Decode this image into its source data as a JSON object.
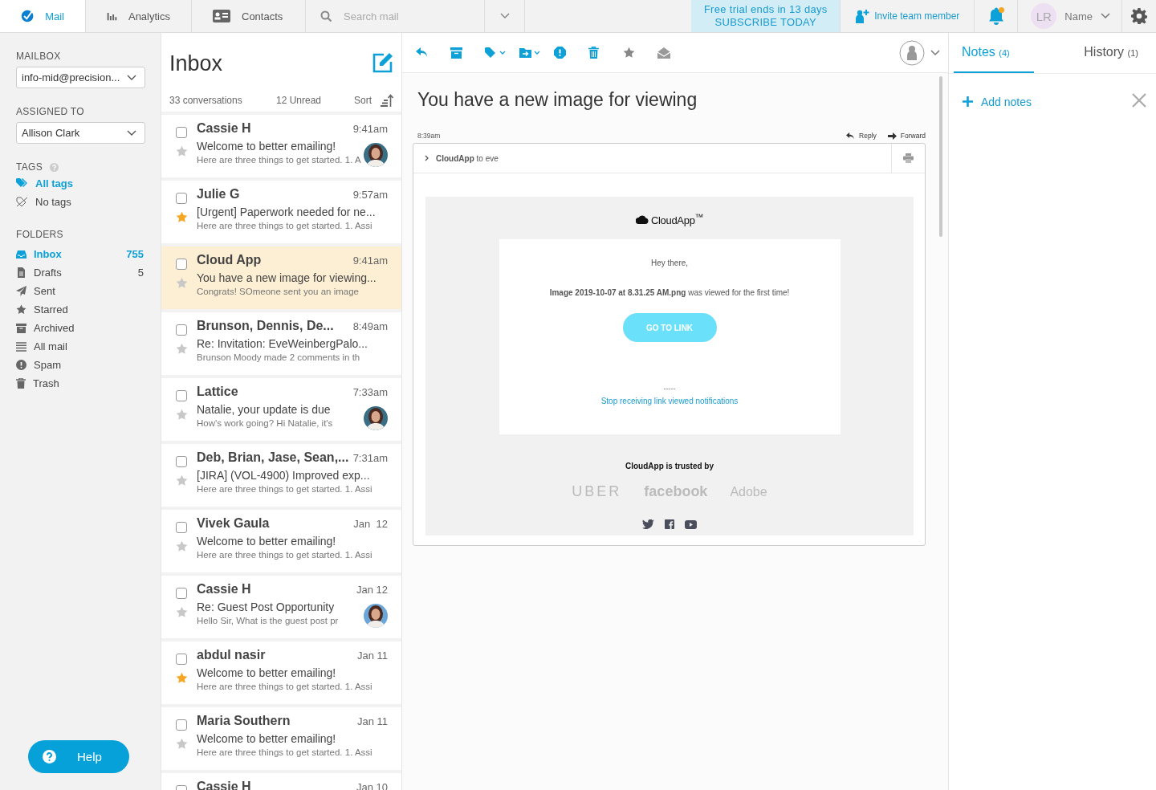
{
  "topbar": {
    "tabs": [
      {
        "label": "Mail",
        "kind": "mail",
        "selected": true
      },
      {
        "label": "Analytics",
        "kind": "analytics",
        "selected": false
      },
      {
        "label": "Contacts",
        "kind": "contacts",
        "selected": false
      }
    ],
    "search": {
      "placeholder": "Search mail"
    },
    "trial": {
      "line1": "Free trial ends in 13 days",
      "line2": "SUBSCRIBE TODAY"
    },
    "invite": "Invite team member",
    "notification_dot": true,
    "user": {
      "initials": "LR",
      "name": "Name"
    }
  },
  "sidebar": {
    "mailbox": {
      "label": "MAILBOX",
      "value": "info-mid@precision..."
    },
    "assigned": {
      "label": "ASSIGNED TO",
      "value": "Allison Clark"
    },
    "tags": {
      "label": "TAGS",
      "items": [
        {
          "label": "All tags",
          "kind": "all",
          "selected": true
        },
        {
          "label": "No tags",
          "kind": "none",
          "selected": false
        }
      ]
    },
    "folders": {
      "label": "FOLDERS",
      "items": [
        {
          "kind": "inbox",
          "label": "Inbox",
          "count": "755",
          "selected": true
        },
        {
          "kind": "drafts",
          "label": "Drafts",
          "count": "5",
          "selected": false
        },
        {
          "kind": "sent",
          "label": "Sent",
          "selected": false
        },
        {
          "kind": "starred",
          "label": "Starred",
          "selected": false
        },
        {
          "kind": "archived",
          "label": "Archived",
          "selected": false
        },
        {
          "kind": "all",
          "label": "All mail",
          "selected": false
        },
        {
          "kind": "spam",
          "label": "Spam",
          "selected": false
        },
        {
          "kind": "trash",
          "label": "Trash",
          "selected": false
        }
      ]
    },
    "help": "Help"
  },
  "list": {
    "title": "Inbox",
    "count": "33 conversations",
    "unread": "12 Unread",
    "sort": "Sort",
    "conversations": [
      {
        "name": "Cassie H",
        "time": "9:41am",
        "subject": "Welcome to better emailing!",
        "preview": "Here are three things to get started. 1. A",
        "starred": false,
        "checked": false,
        "selected": false,
        "avatar": true
      },
      {
        "name": "Julie G",
        "time": "9:57am",
        "subject": "[Urgent] Paperwork needed for ne...",
        "preview": "Here are three things to get started. 1. Assi",
        "starred": true,
        "checked": false,
        "selected": false,
        "avatar": false
      },
      {
        "name": "Cloud App",
        "time": "9:41am",
        "subject": "You have a new image for viewing...",
        "preview": "Congrats! SOmeone sent you an image",
        "starred": false,
        "checked": false,
        "selected": true,
        "avatar": false
      },
      {
        "name": "Brunson, Dennis, De...",
        "time": "8:49am",
        "subject": "Re: Invitation: EveWeinbergPalo...",
        "preview": "Brunson Moody made 2 comments in th",
        "starred": false,
        "checked": false,
        "selected": false,
        "avatar": false
      },
      {
        "name": "Lattice",
        "time": "7:33am",
        "subject": "Natalie, your update is due",
        "preview": "How's work going? Hi Natalie, it's",
        "starred": false,
        "checked": false,
        "selected": false,
        "avatar": true
      },
      {
        "name": "Deb, Brian, Jase, Sean,...",
        "time": "7:31am",
        "subject": "[JIRA] (VOL-4900) Improved exp...",
        "preview": "Here are three things to get started. 1. Assi",
        "starred": false,
        "checked": false,
        "selected": false,
        "avatar": false
      },
      {
        "name": "Vivek Gaula",
        "time": "Jan  12",
        "subject": "Welcome to better emailing!",
        "preview": "Here are three things to get started. 1. Assi",
        "starred": false,
        "checked": false,
        "selected": false,
        "avatar": false
      },
      {
        "name": "Cassie H",
        "time": "Jan 12",
        "subject": "Re: Guest Post Opportunity",
        "preview": "Hello Sir, What is the guest  post pr",
        "starred": false,
        "checked": false,
        "selected": false,
        "avatar": true
      },
      {
        "name": "abdul nasir",
        "time": "Jan 11",
        "subject": "Welcome to better emailing!",
        "preview": "Here are three things to get started. 1. Assi",
        "starred": true,
        "checked": false,
        "selected": false,
        "avatar": false
      },
      {
        "name": "Maria Southern",
        "time": "Jan 11",
        "subject": "Welcome to better emailing!",
        "preview": "Here are three things to get started. 1. Assi",
        "starred": false,
        "checked": false,
        "selected": false,
        "avatar": false
      },
      {
        "name": "Cassie H",
        "time": "Jan 10",
        "checked": false,
        "selected": false,
        "avatar": false
      }
    ]
  },
  "reader": {
    "subject": "You have a new image for viewing",
    "time": "8:39am",
    "reply": "Reply",
    "forward": "Forward",
    "message": {
      "from": "**CloudApp** to eve",
      "logo": "CloudApp$^{™}$",
      "greeting": "Hey there,",
      "body": "**Image 2019-10-07 at 8.31.25 AM.png** was viewed for the first time!",
      "button": "GO TO LINK",
      "separator": "-----",
      "unsubscribe": "Stop receiving link viewed notifications",
      "trusted": "CloudApp is trusted by",
      "brands": [
        "UBER",
        "facebook",
        "Adobe"
      ]
    }
  },
  "notes": {
    "tabs": [
      {
        "label": "Notes",
        "count": "(4)",
        "selected": true
      },
      {
        "label": "History",
        "count": "(1)",
        "selected": false
      }
    ],
    "add": "Add notes"
  }
}
